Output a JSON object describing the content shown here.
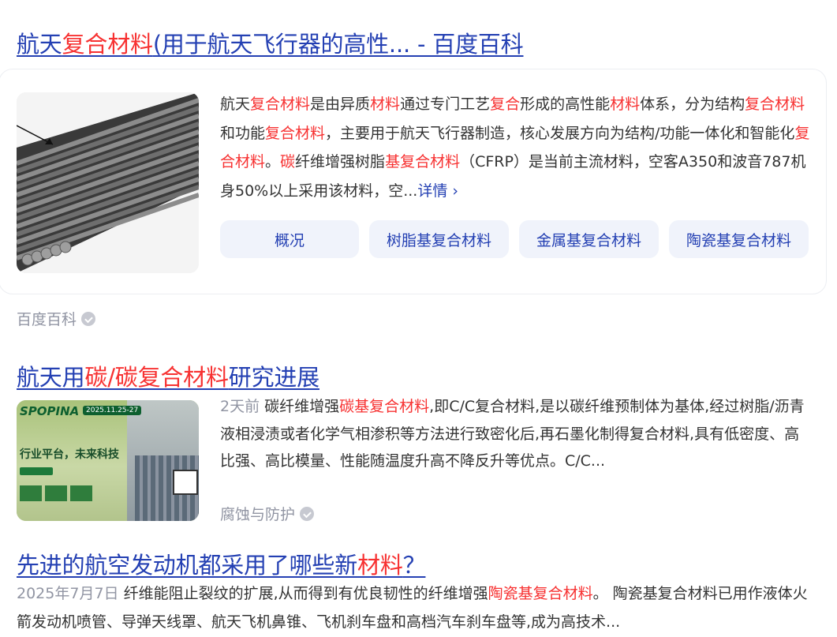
{
  "results": [
    {
      "title_parts": [
        {
          "text": "航天",
          "hl": false
        },
        {
          "text": "复合材料",
          "hl": true
        },
        {
          "text": "(用于航天飞行器的高性... - 百度百科",
          "hl": false
        }
      ],
      "snippet_parts": [
        {
          "text": "航天",
          "hl": false
        },
        {
          "text": "复合材料",
          "hl": true
        },
        {
          "text": "是由异质",
          "hl": false
        },
        {
          "text": "材料",
          "hl": true
        },
        {
          "text": "通过专门工艺",
          "hl": false
        },
        {
          "text": "复合",
          "hl": true
        },
        {
          "text": "形成的高性能",
          "hl": false
        },
        {
          "text": "材料",
          "hl": true
        },
        {
          "text": "体系，分为结构",
          "hl": false
        },
        {
          "text": "复合材料",
          "hl": true
        },
        {
          "text": "和功能",
          "hl": false
        },
        {
          "text": "复合材料",
          "hl": true
        },
        {
          "text": "，主要用于航天飞行器制造，核心发展方向为结构/功能一体化和智能化",
          "hl": false
        },
        {
          "text": "复合材料",
          "hl": true
        },
        {
          "text": "。",
          "hl": false
        },
        {
          "text": "碳",
          "hl": true
        },
        {
          "text": "纤维增强树脂",
          "hl": false
        },
        {
          "text": "基复合材料",
          "hl": true
        },
        {
          "text": "（CFRP）是当前主流材料，空客A350和波音787机身50%以上采用该材料，空...",
          "hl": false
        }
      ],
      "more_label": "详情",
      "chips": [
        "概况",
        "树脂基复合材料",
        "金属基复合材料",
        "陶瓷基复合材料"
      ],
      "source": "百度百科"
    },
    {
      "title_parts": [
        {
          "text": "航天用",
          "hl": false
        },
        {
          "text": "碳/碳复合材料",
          "hl": true
        },
        {
          "text": "研究进展",
          "hl": false
        }
      ],
      "date": "2天前",
      "snippet_parts": [
        {
          "text": "碳纤维增强",
          "hl": false
        },
        {
          "text": "碳基复合材料",
          "hl": true
        },
        {
          "text": ",即C/C复合材料,是以碳纤维预制体为基体,经过树脂/沥青液相浸渍或者化学气相渗积等方法进行致密化后,再石墨化制得复合材料,具有低密度、高比强、高比模量、性能随温度升高不降反升等优点。C/C...",
          "hl": false
        }
      ],
      "thumb": {
        "brand": "SPOPINA",
        "date_badge": "2025.11.25-27",
        "slogan": "行业平台，未来科技"
      },
      "source": "腐蚀与防护"
    },
    {
      "title_parts": [
        {
          "text": "先进的航空发动机都采用了哪些新",
          "hl": false
        },
        {
          "text": "材料",
          "hl": true
        },
        {
          "text": "？",
          "hl": false
        }
      ],
      "date": "2025年7月7日",
      "snippet_parts": [
        {
          "text": "纤维能阻止裂纹的扩展,从而得到有优良韧性的纤维增强",
          "hl": false
        },
        {
          "text": "陶瓷基复合材料",
          "hl": true
        },
        {
          "text": "。 陶瓷基复合材料已用作液体火箭发动机喷管、导弹天线罩、航天飞机鼻锥、飞机刹车盘和高档汽车刹车盘等,成为高技术...",
          "hl": false
        }
      ]
    }
  ],
  "colors": {
    "link": "#2440b3",
    "highlight": "#f73131",
    "meta": "#9195a3",
    "chip_bg": "#f0f3fb"
  }
}
